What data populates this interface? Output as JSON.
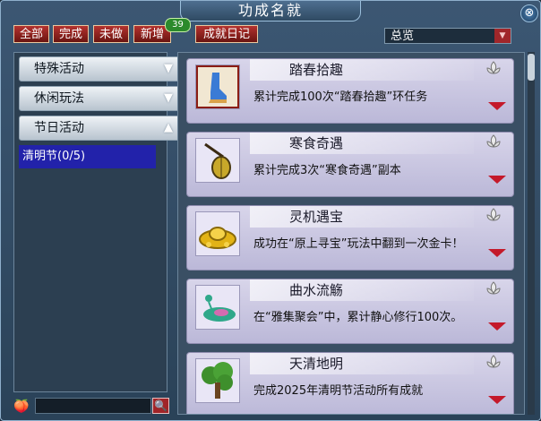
{
  "window": {
    "title": "功成名就",
    "close_glyph": "⊗"
  },
  "tabs": [
    {
      "label": "全部"
    },
    {
      "label": "完成"
    },
    {
      "label": "未做"
    },
    {
      "label": "新增",
      "badge": "39"
    },
    {
      "label": "成就日记"
    }
  ],
  "filter": {
    "selected": "总览",
    "arrow": "▼"
  },
  "categories": [
    {
      "label": "特殊活动",
      "arrow": "▼"
    },
    {
      "label": "休闲玩法",
      "arrow": "▼"
    },
    {
      "label": "节日活动",
      "arrow": "▲"
    }
  ],
  "selected_sub": "清明节(0/5)",
  "search": {
    "placeholder": "",
    "icon_glyph": "🍑",
    "button_glyph": "🔍"
  },
  "achievements": [
    {
      "title": "踏春拾趣",
      "desc": "累计完成100次“踏春拾趣”环任务",
      "icon": "boots-icon"
    },
    {
      "title": "寒食奇遇",
      "desc": "累计完成3次“寒食奇遇”副本",
      "icon": "lantern-icon"
    },
    {
      "title": "灵机遇宝",
      "desc": "成功在“原上寻宝”玩法中翻到一次金卡！",
      "icon": "gold-ingot-icon"
    },
    {
      "title": "曲水流觞",
      "desc": "在“雅集聚会”中，累计静心修行100次。",
      "icon": "lotus-cup-icon"
    },
    {
      "title": "天清地明",
      "desc": "完成2025年清明节活动所有成就",
      "icon": "tree-icon"
    }
  ]
}
